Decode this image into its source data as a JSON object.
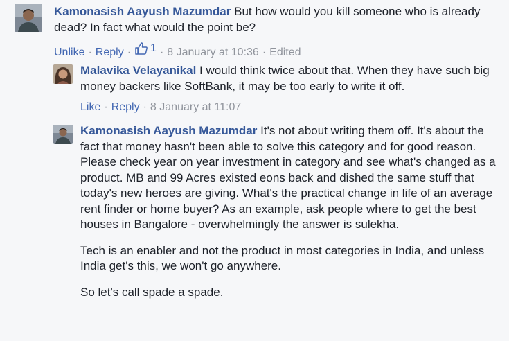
{
  "comments": [
    {
      "author": "Kamonasish Aayush Mazumdar",
      "paragraphs": [
        "But how would you kill someone who is already dead? In fact what would the point be?"
      ],
      "actions": {
        "primary": "Unlike",
        "reply": "Reply",
        "like_count": "1",
        "time": "8 January at 10:36",
        "edited": "Edited"
      },
      "separator": "·"
    },
    {
      "author": "Malavika Velayanikal",
      "paragraphs": [
        "I would think twice about that. When they have such big money backers like SoftBank, it may be too early to write it off."
      ],
      "actions": {
        "primary": "Like",
        "reply": "Reply",
        "time": "8 January at 11:07"
      },
      "separator": "·"
    },
    {
      "author": "Kamonasish Aayush Mazumdar",
      "paragraphs": [
        "It's not about writing them off. It's about the fact that money hasn't been able to solve this category and for good reason.",
        "Please check year on year investment in category and see what's changed as a product. MB and 99 Acres existed eons back and dished the same stuff that today's new heroes are giving. What's the practical change in life of an average rent finder or home buyer? As an example, ask people where to get the best houses in Bangalore - overwhelmingly the answer is sulekha.",
        "Tech is an enabler and not the product in most categories in India, and unless India get's this, we won't go anywhere.",
        "So let's call spade a spade."
      ],
      "separator": "·"
    }
  ],
  "colors": {
    "background": "#f6f7f9",
    "author": "#365899",
    "action": "#4267b2",
    "meta": "#90949c",
    "text": "#1d2129"
  },
  "icons": {
    "like_count": "thumbs-up-icon"
  }
}
